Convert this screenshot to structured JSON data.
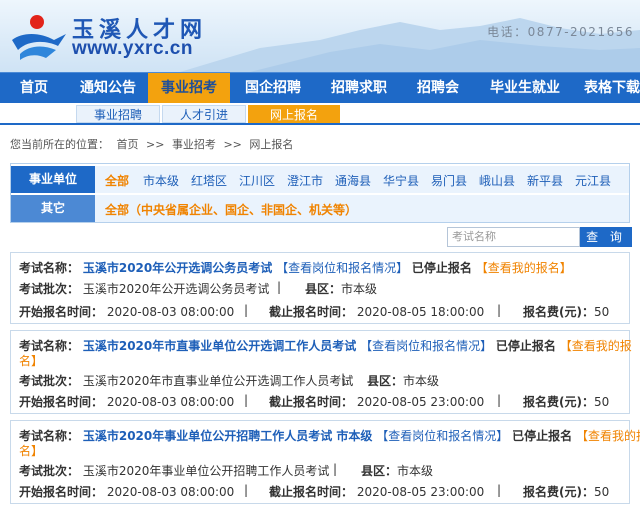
{
  "header": {
    "site_title": "玉溪人才网",
    "site_url": "www.yxrc.cn",
    "phone": "电话：0877-2021656"
  },
  "nav": {
    "items": [
      "首页",
      "通知公告",
      "事业招考",
      "国企招聘",
      "招聘求职",
      "招聘会",
      "毕业生就业",
      "表格下载"
    ],
    "active_index": 2
  },
  "subnav": {
    "items": [
      "事业招聘",
      "人才引进",
      "网上报名"
    ],
    "active_index": 2
  },
  "breadcrumb": {
    "prefix": "您当前所在的位置：",
    "items": [
      "首页",
      ">>",
      "事业招考",
      ">>",
      "网上报名"
    ]
  },
  "filter": {
    "unit_label": "事业单位",
    "unit_options": [
      "全部",
      "市本级",
      "红塔区",
      "江川区",
      "澄江市",
      "通海县",
      "华宁县",
      "易门县",
      "峨山县",
      "新平县",
      "元江县"
    ],
    "other_label": "其它",
    "other_option": "全部（中央省属企业、国企、非国企、机关等）"
  },
  "search": {
    "placeholder": "考试名称",
    "button_label": "查 询"
  },
  "labels": {
    "exam_name": "考试名称：",
    "batch": "考试批次：",
    "district": "县区：",
    "start_time": "开始报名时间：",
    "end_time": "截止报名时间：",
    "fee": "报名费(元)：",
    "view_positions": "【查看岗位和报名情况】",
    "view_mine": "【查看我的报名】",
    "view_mine_wrap_a": "【查看我的报",
    "view_mine_wrap_b": "名】",
    "sep": "|"
  },
  "exams": [
    {
      "name": "玉溪市2020年公开选调公务员考试",
      "status": "已停止报名",
      "batch": "玉溪市2020年公开选调公务员考试",
      "district": "市本级",
      "start": "2020-08-03 08:00:00",
      "end": "2020-08-05 18:00:00",
      "fee": "50"
    },
    {
      "name": "玉溪市2020年市直事业单位公开选调工作人员考试",
      "status": "已停止报名",
      "batch": "玉溪市2020年市直事业单位公开选调工作人员考试",
      "district": "市本级",
      "start": "2020-08-03 08:00:00",
      "end": "2020-08-05 23:00:00",
      "fee": "50"
    },
    {
      "name": "玉溪市2020年事业单位公开招聘工作人员考试 市本级",
      "status": "已停止报名",
      "batch": "玉溪市2020年事业单位公开招聘工作人员考试",
      "district": "市本级",
      "start": "2020-08-03 08:00:00",
      "end": "2020-08-05 23:00:00",
      "fee": "50"
    }
  ]
}
